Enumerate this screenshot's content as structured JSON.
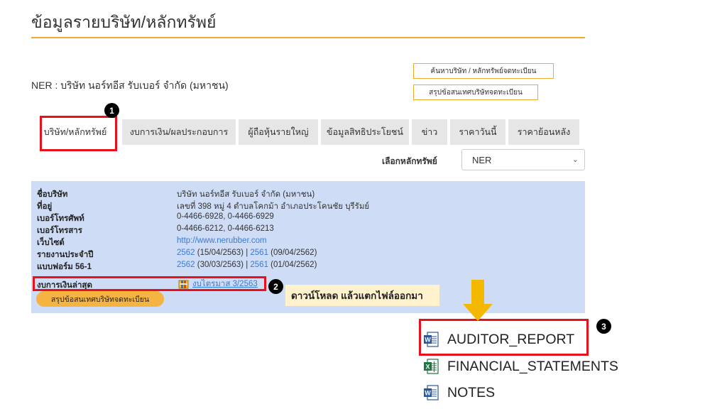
{
  "page": {
    "title": "ข้อมูลรายบริษัท/หลักทรัพย์",
    "company_name": "NER : บริษัท นอร์ทอีส รับเบอร์ จำกัด (มหาชน)",
    "buttons": {
      "search_listed": "ค้นหาบริษัท / หลักทรัพย์จดทะเบียน",
      "summary_listed": "สรุปข้อสนเทศบริษัทจดทะเบียน"
    }
  },
  "tabs": [
    {
      "label": "บริษัท/หลักทรัพย์",
      "active": true
    },
    {
      "label": "งบการเงิน/ผลประกอบการ",
      "active": false
    },
    {
      "label": "ผู้ถือหุ้นรายใหญ่",
      "active": false
    },
    {
      "label": "ข้อมูลสิทธิประโยชน์",
      "active": false
    },
    {
      "label": "ข่าว",
      "active": false
    },
    {
      "label": "ราคาวันนี้",
      "active": false
    },
    {
      "label": "ราคาย้อนหลัง",
      "active": false
    }
  ],
  "security_select": {
    "label": "เลือกหลักทรัพย์",
    "value": "NER"
  },
  "info": {
    "company_label": "ชื่อบริษัท",
    "company_value": "บริษัท นอร์ทอีส รับเบอร์ จำกัด (มหาชน)",
    "address_label": "ที่อยู่",
    "address_value": "เลขที่ 398 หมู่ 4 ตำบลโคกม้า อำเภอประโคนชัย บุรีรัมย์",
    "phone_label": "เบอร์โทรศัพท์",
    "phone_value": "0-4466-6928, 0-4466-6929",
    "fax_label": "เบอร์โทรสาร",
    "fax_value": "0-4466-6212, 0-4466-6213",
    "website_label": "เว็บไซต์",
    "website_value": "http://www.nerubber.com",
    "annual_report_label": "รายงานประจำปี",
    "annual_report": {
      "link1": "2562",
      "date1": " (15/04/2563) | ",
      "link2": "2561",
      "date2": " (09/04/2562)"
    },
    "form561_label": "แบบฟอร์ม 56-1",
    "form561": {
      "link1": "2562",
      "date1": " (30/03/2563) | ",
      "link2": "2561",
      "date2": " (01/04/2562)"
    },
    "latest_fs_label": "งบการเงินล่าสุด",
    "latest_fs_value": "งบไตรมาส 3/2563",
    "summary_pill": "สรุปข้อสนเทศบริษัทจดทะเบียน"
  },
  "annotations": {
    "markers": [
      "1",
      "2",
      "3"
    ],
    "note": "ดาวน์โหลด แล้วแตกไฟล์ออกมา",
    "colors": {
      "highlight": "#e8111b",
      "arrow": "#f5b800",
      "note_bg": "#fff2cc"
    }
  },
  "files": [
    {
      "name": "AUDITOR_REPORT",
      "icon": "word-doc-icon"
    },
    {
      "name": "FINANCIAL_STATEMENTS",
      "icon": "excel-sheet-icon"
    },
    {
      "name": "NOTES",
      "icon": "word-doc-icon"
    }
  ]
}
